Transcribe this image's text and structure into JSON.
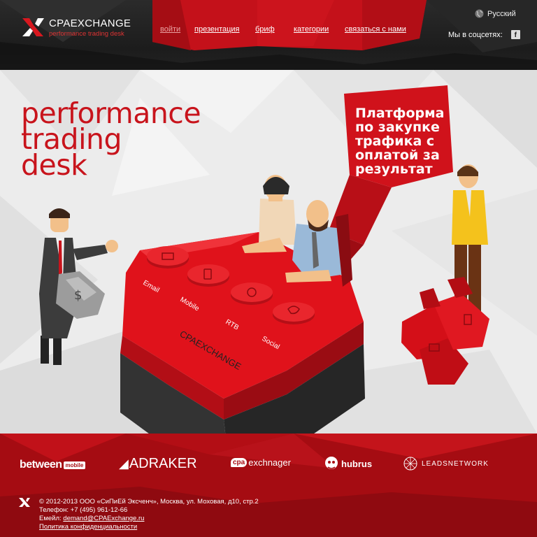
{
  "header": {
    "logo": {
      "name": "CPAEXCHANGE",
      "tagline": "performance trading desk"
    },
    "nav": [
      {
        "label": "войти"
      },
      {
        "label": "презентация"
      },
      {
        "label": "бриф"
      },
      {
        "label": "категории"
      },
      {
        "label": "связаться с нами"
      }
    ],
    "language": "Русский",
    "social_label": "Мы в соцсетях:",
    "social_icon": "f"
  },
  "hero": {
    "headline": [
      "performance",
      "trading",
      "desk"
    ],
    "bubble": [
      "Платформа",
      "по закупке",
      "трафика с",
      "оплатой за",
      "результат"
    ],
    "desk_brand": "CPAEXCHANGE",
    "channels": [
      "Email",
      "Mobile",
      "RTB",
      "Social"
    ]
  },
  "footer": {
    "partners": {
      "between": "between",
      "between_tag": "mobile",
      "adraker": "ADRAKER",
      "cpa_badge": "cpa",
      "cpa_text": "exchnager",
      "hubrus": "hubrus",
      "leads": "LEADSNETWORK"
    },
    "copyright": "© 2012-2013 ООО «СиПиЕй Эксченч», Москва, ул. Моховая, д10, стр.2",
    "phone": "Телефон: +7 (495) 961-12-66",
    "email_label": "Емейл: ",
    "email": "demand@CPAExchange.ru",
    "privacy": "Политика конфиденциальности"
  },
  "colors": {
    "brand_red": "#c8141c",
    "header_dark": "#222222",
    "footer_red": "#a80c12"
  }
}
